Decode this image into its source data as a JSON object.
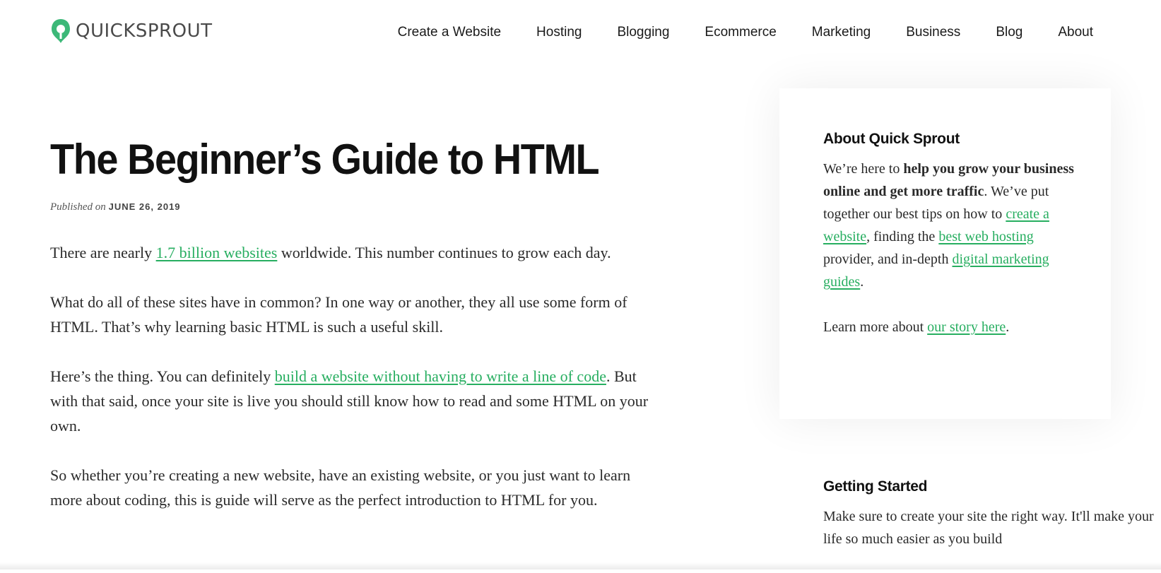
{
  "header": {
    "logo_text": "QUICKSPROUT",
    "nav": [
      {
        "label": "Create a Website"
      },
      {
        "label": "Hosting"
      },
      {
        "label": "Blogging"
      },
      {
        "label": "Ecommerce"
      },
      {
        "label": "Marketing"
      },
      {
        "label": "Business"
      },
      {
        "label": "Blog"
      },
      {
        "label": "About"
      }
    ]
  },
  "post": {
    "title": "The Beginner’s Guide to HTML",
    "published_prefix": "Published on",
    "published_date": "JUNE 26, 2019",
    "p1": {
      "before": "There are nearly ",
      "link": "1.7 billion websites",
      "after": " worldwide. This number continues to grow each day."
    },
    "p2": "What do all of these sites have in common? In one way or another, they all use some form of HTML. That’s why learning basic HTML is such a useful skill.",
    "p3": {
      "before": "Here’s the thing. You can definitely ",
      "link": "build a website without having to write a line of code",
      "after": ". But with that said, once your site is live you should still know how to read and some HTML on your own."
    },
    "p4": "So whether you’re creating a new website, have an existing website, or you just want to learn more about coding, this is guide will serve as the perfect introduction to HTML for you."
  },
  "sidebar": {
    "about": {
      "title": "About Quick Sprout",
      "t1": "We’re here to ",
      "bold": "help you grow your business online and get more traffic",
      "t2": ". We’ve put together our best tips on how to ",
      "link1": "create a website",
      "t3": ", finding the ",
      "link2": "best web hosting",
      "t4": " provider, and in-depth ",
      "link3": "digital marketing guides",
      "t5": ".",
      "learn_before": "Learn more about ",
      "learn_link": "our story here",
      "learn_after": "."
    },
    "getting_started": {
      "title": "Getting Started",
      "text": "Make sure to create your site the right way. It'll make your life so much easier as you build"
    }
  },
  "colors": {
    "accent": "#27ae60",
    "logo_icon": "#3cb878"
  }
}
